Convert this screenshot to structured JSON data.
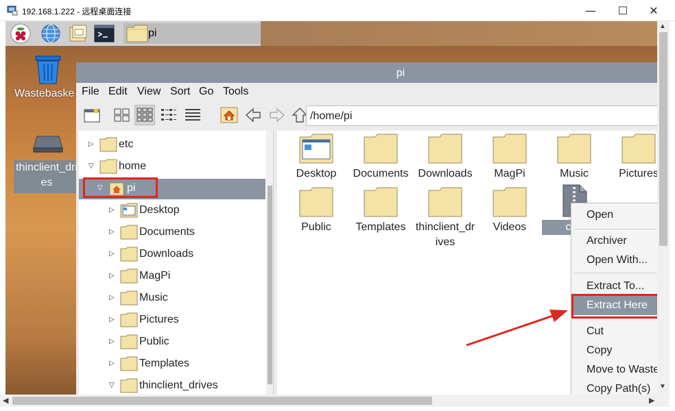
{
  "rdp": {
    "title": "192.168.1.222 - 远程桌面连接",
    "min_glyph": "—",
    "max_glyph": "☐",
    "close_glyph": "✕"
  },
  "panel": {
    "icons": [
      "raspberry-menu-icon",
      "web-browser-icon",
      "file-manager-icon",
      "terminal-icon"
    ],
    "task_label": "pi"
  },
  "desktop": {
    "wastebasket_label": "Wastebaske",
    "drive_label_line1": "thinclient_dri",
    "drive_label_line2": "es"
  },
  "fm": {
    "title": "pi",
    "menu": [
      "File",
      "Edit",
      "View",
      "Sort",
      "Go",
      "Tools"
    ],
    "path": "/home/pi",
    "toolbar_icons": [
      "new-window-icon",
      "icon-view-icon",
      "thumbnail-view-icon",
      "compact-view-icon",
      "list-view-icon",
      "home-icon",
      "back-icon",
      "forward-icon",
      "up-icon"
    ],
    "tree": [
      {
        "label": "etc",
        "expanded": false
      },
      {
        "label": "home",
        "expanded": true
      },
      {
        "label": "pi",
        "expanded": true,
        "selected": true,
        "home": true
      },
      {
        "label": "Desktop",
        "expanded": false,
        "desktop": true
      },
      {
        "label": "Documents",
        "expanded": false
      },
      {
        "label": "Downloads",
        "expanded": false
      },
      {
        "label": "MagPi",
        "expanded": false
      },
      {
        "label": "Music",
        "expanded": false
      },
      {
        "label": "Pictures",
        "expanded": false
      },
      {
        "label": "Public",
        "expanded": false
      },
      {
        "label": "Templates",
        "expanded": false
      },
      {
        "label": "thinclient_drives",
        "expanded": true
      }
    ],
    "files": [
      {
        "label": "Desktop"
      },
      {
        "label": "Documents"
      },
      {
        "label": "Downloads"
      },
      {
        "label": "MagPi"
      },
      {
        "label": "Music"
      },
      {
        "label": "Pictures"
      },
      {
        "label": "Public"
      },
      {
        "label": "Templates"
      },
      {
        "label_line1": "thinclient_dr",
        "label_line2": "ives"
      },
      {
        "label": "Videos"
      },
      {
        "label": "coc",
        "selected": true,
        "archive": true
      }
    ]
  },
  "context_menu": {
    "items": [
      "Open",
      "Archiver",
      "Open With...",
      "Extract To...",
      "Extract Here",
      "Cut",
      "Copy",
      "Move to Waste",
      "Copy Path(s)"
    ],
    "highlighted": "Extract Here"
  },
  "colors": {
    "selection": "#8a95a1",
    "annotation": "#e0261f",
    "folder": "#f5e2a6"
  }
}
